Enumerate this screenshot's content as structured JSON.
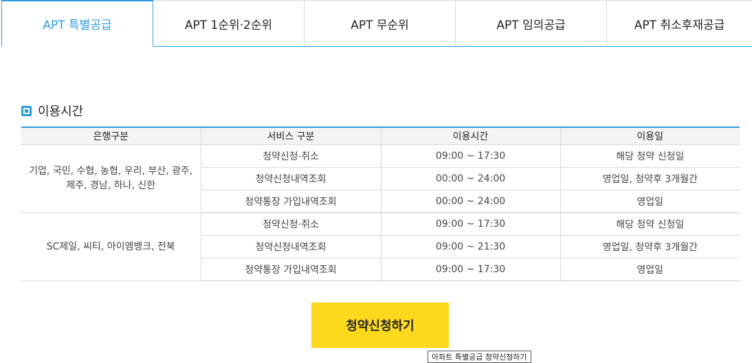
{
  "tabs": [
    {
      "label": "APT 특별공급",
      "active": true
    },
    {
      "label": "APT 1순위·2순위",
      "active": false
    },
    {
      "label": "APT 무순위",
      "active": false
    },
    {
      "label": "APT 임의공급",
      "active": false
    },
    {
      "label": "APT 취소후재공급",
      "active": false
    }
  ],
  "section": {
    "title": "이용시간"
  },
  "table": {
    "headers": [
      "은행구분",
      "서비스 구분",
      "이용시간",
      "이용일"
    ],
    "groups": [
      {
        "bank": "기업, 국민, 수협, 농협, 우리, 부산, 광주, 제주, 경남, 하나, 신한",
        "rows": [
          {
            "service": "청약신청·취소",
            "time": "09:00 ~ 17:30",
            "days": "해당 청약 신청일"
          },
          {
            "service": "청약신청내역조회",
            "time": "00:00 ~ 24:00",
            "days": "영업일, 청약후 3개월간"
          },
          {
            "service": "청약통장 가입내역조회",
            "time": "00:00 ~ 24:00",
            "days": "영업일"
          }
        ]
      },
      {
        "bank": "SC제일, 씨티, 아이엠뱅크, 전북",
        "rows": [
          {
            "service": "청약신청·취소",
            "time": "09:00 ~ 17:30",
            "days": "해당 청약 신청일"
          },
          {
            "service": "청약신청내역조회",
            "time": "09:00 ~ 21:30",
            "days": "영업일, 청약후 3개월간"
          },
          {
            "service": "청약통장 가입내역조회",
            "time": "09:00 ~ 17:30",
            "days": "영업일"
          }
        ]
      }
    ]
  },
  "apply_button": {
    "label": "청약신청하기",
    "color": "#fdd91e"
  },
  "tooltip": {
    "text": "아파트 특별공급 청약신청하기"
  },
  "colors": {
    "accent": "#2b9be0",
    "header_bg": "#f4f4f4"
  },
  "icons": {
    "section_marker": "square-bullet-icon"
  }
}
